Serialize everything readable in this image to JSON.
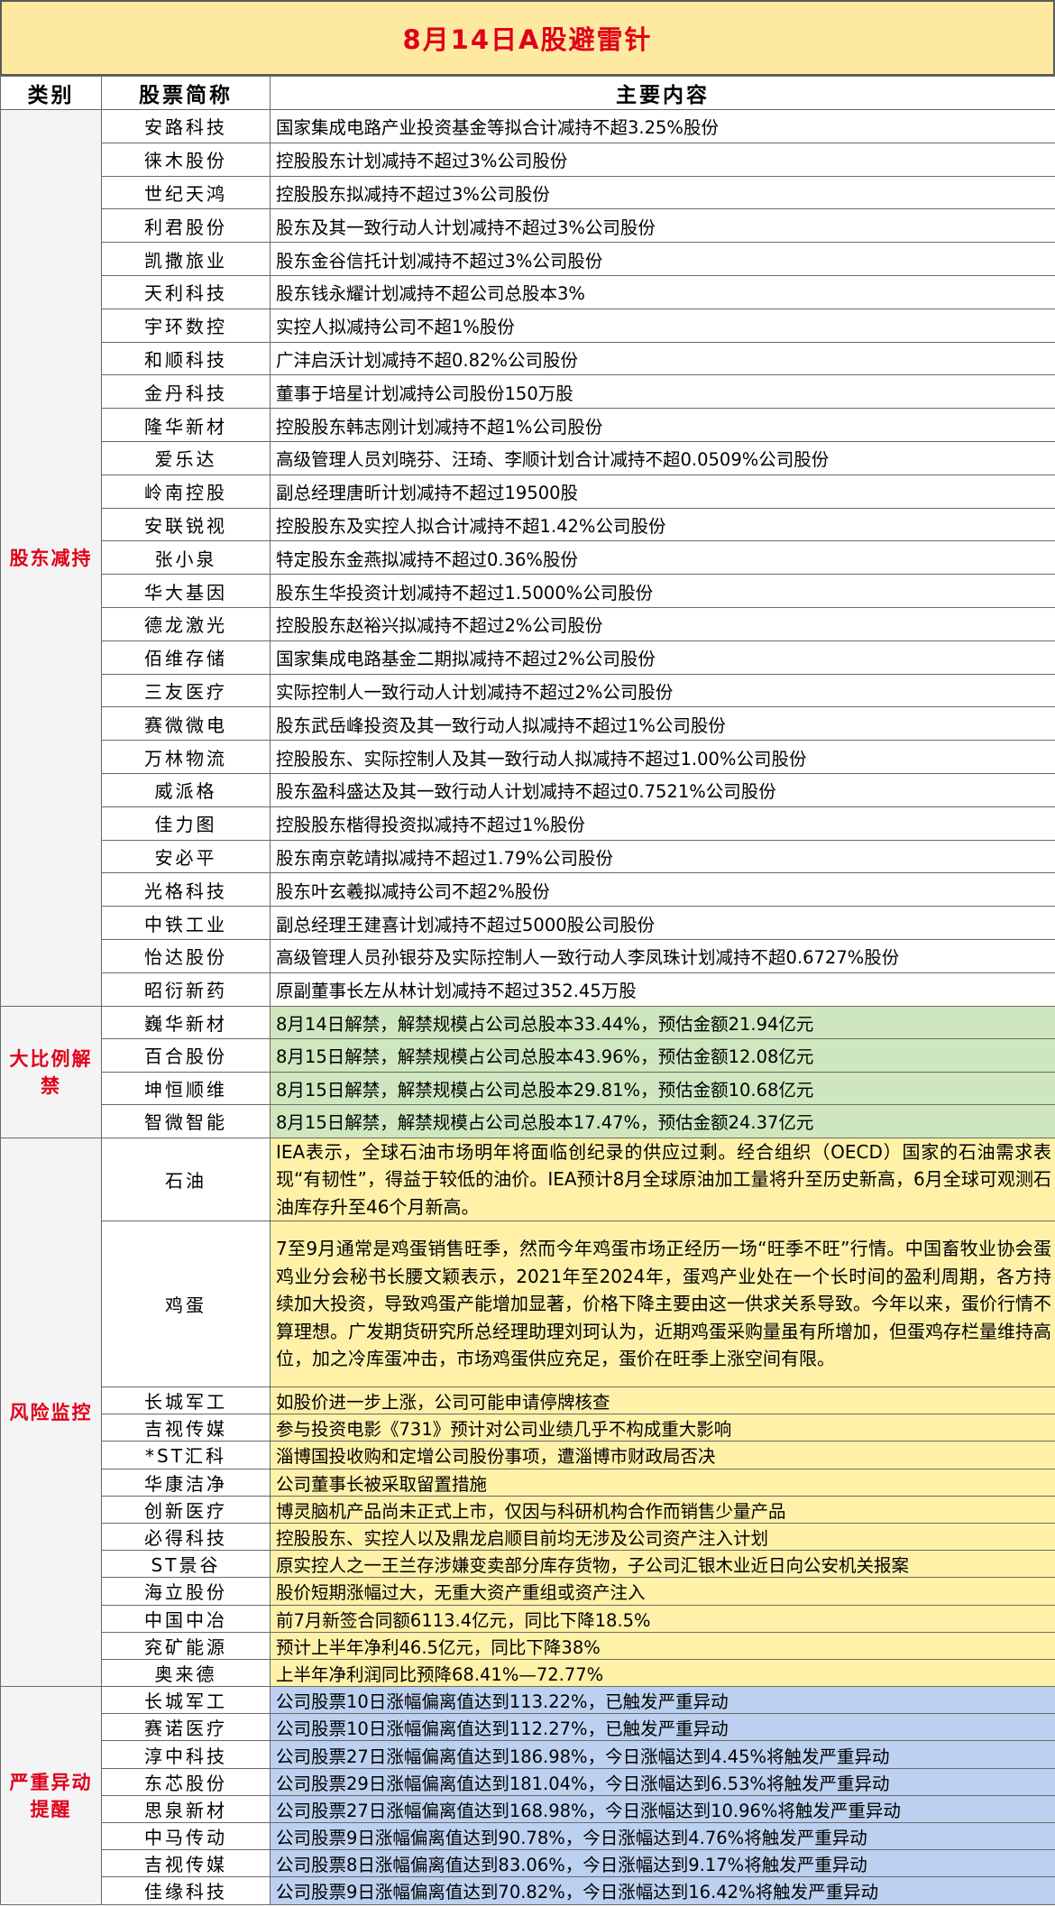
{
  "title": "8月14日A股避雷针",
  "headers": {
    "category": "类别",
    "stock": "股票简称",
    "content": "主要内容"
  },
  "colors": {
    "title_bg": "#fde9a0",
    "title_text": "#e0001b",
    "category_text": "#e0001b",
    "unlock_bg": "#cfe7bf",
    "risk_bg": "#fff2a8",
    "abnormal_bg": "#bcd0ef"
  },
  "sections": [
    {
      "category": "股东减持",
      "rows": [
        {
          "name": "安路科技",
          "content": "国家集成电路产业投资基金等拟合计减持不超3.25%股份"
        },
        {
          "name": "徕木股份",
          "content": "控股股东计划减持不超过3%公司股份"
        },
        {
          "name": "世纪天鸿",
          "content": "控股股东拟减持不超过3%公司股份"
        },
        {
          "name": "利君股份",
          "content": "股东及其一致行动人计划减持不超过3%公司股份"
        },
        {
          "name": "凯撒旅业",
          "content": "股东金谷信托计划减持不超过3%公司股份"
        },
        {
          "name": "天利科技",
          "content": "股东钱永耀计划减持不超公司总股本3%"
        },
        {
          "name": "宇环数控",
          "content": "实控人拟减持公司不超1%股份"
        },
        {
          "name": "和顺科技",
          "content": "广沣启沃计划减持不超0.82%公司股份"
        },
        {
          "name": "金丹科技",
          "content": "董事于培星计划减持公司股份150万股"
        },
        {
          "name": "隆华新材",
          "content": "控股股东韩志刚计划减持不超1%公司股份"
        },
        {
          "name": "爱乐达",
          "content": "高级管理人员刘晓芬、汪琦、李顺计划合计减持不超0.0509%公司股份"
        },
        {
          "name": "岭南控股",
          "content": "副总经理唐昕计划减持不超过19500股"
        },
        {
          "name": "安联锐视",
          "content": "控股股东及实控人拟合计减持不超1.42%公司股份"
        },
        {
          "name": "张小泉",
          "content": "特定股东金燕拟减持不超过0.36%股份"
        },
        {
          "name": "华大基因",
          "content": "股东生华投资计划减持不超过1.5000%公司股份"
        },
        {
          "name": "德龙激光",
          "content": "控股股东赵裕兴拟减持不超过2%公司股份"
        },
        {
          "name": "佰维存储",
          "content": "国家集成电路基金二期拟减持不超过2%公司股份"
        },
        {
          "name": "三友医疗",
          "content": "实际控制人一致行动人计划减持不超过2%公司股份"
        },
        {
          "name": "赛微微电",
          "content": "股东武岳峰投资及其一致行动人拟减持不超过1%公司股份"
        },
        {
          "name": "万林物流",
          "content": "控股股东、实际控制人及其一致行动人拟减持不超过1.00%公司股份"
        },
        {
          "name": "威派格",
          "content": "股东盈科盛达及其一致行动人计划减持不超过0.7521%公司股份"
        },
        {
          "name": "佳力图",
          "content": "控股股东楷得投资拟减持不超过1%股份"
        },
        {
          "name": "安必平",
          "content": "股东南京乾靖拟减持不超过1.79%公司股份"
        },
        {
          "name": "光格科技",
          "content": "股东叶玄羲拟减持公司不超2%股份"
        },
        {
          "name": "中铁工业",
          "content": "副总经理王建喜计划减持不超过5000股公司股份"
        },
        {
          "name": "怡达股份",
          "content": "高级管理人员孙银芬及实际控制人一致行动人李凤珠计划减持不超0.6727%股份"
        },
        {
          "name": "昭衍新药",
          "content": "原副董事长左从林计划减持不超过352.45万股"
        }
      ]
    },
    {
      "category": "大比例解禁",
      "rows": [
        {
          "name": "巍华新材",
          "content": "8月14日解禁，解禁规模占公司总股本33.44%，预估金额21.94亿元"
        },
        {
          "name": "百合股份",
          "content": "8月15日解禁，解禁规模占公司总股本43.96%，预估金额12.08亿元"
        },
        {
          "name": "坤恒顺维",
          "content": "8月15日解禁，解禁规模占公司总股本29.81%，预估金额10.68亿元"
        },
        {
          "name": "智微智能",
          "content": "8月15日解禁，解禁规模占公司总股本17.47%，预估金额24.37亿元"
        }
      ]
    },
    {
      "category": "风险监控",
      "rows": [
        {
          "name": "石油",
          "content": "IEA表示，全球石油市场明年将面临创纪录的供应过剩。经合组织（OECD）国家的石油需求表现“有韧性”，得益于较低的油价。IEA预计8月全球原油加工量将升至历史新高，6月全球可观测石油库存升至46个月新高。"
        },
        {
          "name": "鸡蛋",
          "content": "7至9月通常是鸡蛋销售旺季，然而今年鸡蛋市场正经历一场“旺季不旺”行情。中国畜牧业协会蛋鸡业分会秘书长腰文颖表示，2021年至2024年，蛋鸡产业处在一个长时间的盈利周期，各方持续加大投资，导致鸡蛋产能增加显著，价格下降主要由这一供求关系导致。今年以来，蛋价行情不算理想。广发期货研究所总经理助理刘珂认为，近期鸡蛋采购量虽有所增加，但蛋鸡存栏量维持高位，加之冷库蛋冲击，市场鸡蛋供应充足，蛋价在旺季上涨空间有限。"
        },
        {
          "name": "长城军工",
          "content": "如股价进一步上涨，公司可能申请停牌核查"
        },
        {
          "name": "吉视传媒",
          "content": "参与投资电影《731》预计对公司业绩几乎不构成重大影响"
        },
        {
          "name": "*ST汇科",
          "content": "淄博国投收购和定增公司股份事项，遭淄博市财政局否决"
        },
        {
          "name": "华康洁净",
          "content": "公司董事长被采取留置措施"
        },
        {
          "name": "创新医疗",
          "content": "博灵脑机产品尚未正式上市，仅因与科研机构合作而销售少量产品"
        },
        {
          "name": "必得科技",
          "content": "控股股东、实控人以及鼎龙启顺目前均无涉及公司资产注入计划"
        },
        {
          "name": "ST景谷",
          "content": "原实控人之一王兰存涉嫌变卖部分库存货物，子公司汇银木业近日向公安机关报案"
        },
        {
          "name": "海立股份",
          "content": "股价短期涨幅过大，无重大资产重组或资产注入"
        },
        {
          "name": "中国中冶",
          "content": "前7月新签合同额6113.4亿元，同比下降18.5%"
        },
        {
          "name": "兖矿能源",
          "content": "预计上半年净利46.5亿元，同比下降38%"
        },
        {
          "name": "奥来德",
          "content": "上半年净利润同比预降68.41%—72.77%"
        }
      ]
    },
    {
      "category": "严重异动提醒",
      "rows": [
        {
          "name": "长城军工",
          "content": "公司股票10日涨幅偏离值达到113.22%，已触发严重异动"
        },
        {
          "name": "赛诺医疗",
          "content": "公司股票10日涨幅偏离值达到112.27%，已触发严重异动"
        },
        {
          "name": "淳中科技",
          "content": "公司股票27日涨幅偏离值达到186.98%，今日涨幅达到4.45%将触发严重异动"
        },
        {
          "name": "东芯股份",
          "content": "公司股票29日涨幅偏离值达到181.04%，今日涨幅达到6.53%将触发严重异动"
        },
        {
          "name": "思泉新材",
          "content": "公司股票27日涨幅偏离值达到168.98%，今日涨幅达到10.96%将触发严重异动"
        },
        {
          "name": "中马传动",
          "content": "公司股票9日涨幅偏离值达到90.78%，今日涨幅达到4.76%将触发严重异动"
        },
        {
          "name": "吉视传媒",
          "content": "公司股票8日涨幅偏离值达到83.06%，今日涨幅达到9.17%将触发严重异动"
        },
        {
          "name": "佳缘科技",
          "content": "公司股票9日涨幅偏离值达到70.82%，今日涨幅达到16.42%将触发严重异动"
        }
      ]
    }
  ]
}
